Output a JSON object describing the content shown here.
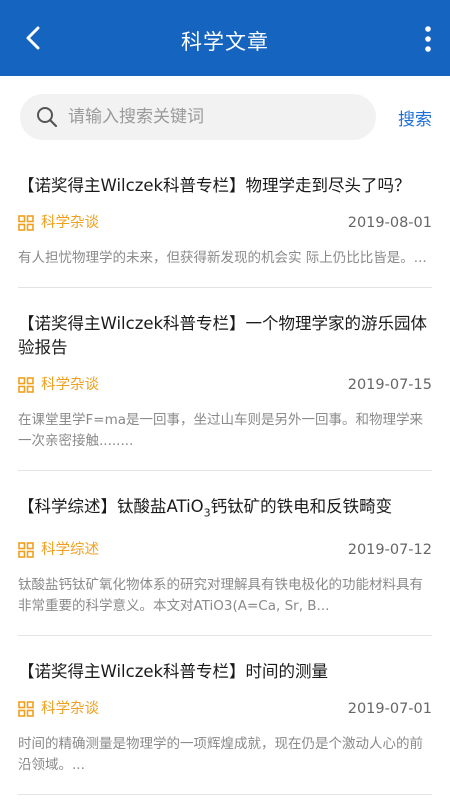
{
  "header": {
    "title": "科学文章",
    "back_icon": "chevron-left-icon",
    "more_icon": "more-vert-icon",
    "bg_color": "#1565c0"
  },
  "search": {
    "placeholder": "请输入搜索关键词",
    "value": "",
    "button_label": "搜索",
    "icon": "search-icon"
  },
  "articles": [
    {
      "title": "【诺奖得主Wilczek科普专栏】物理学走到尽头了吗？",
      "category": "科学杂谈",
      "date": "2019-08-01",
      "summary": "有人担忧物理学的未来，但获得新发现的机会实 际上仍比比皆是。..."
    },
    {
      "title": "【诺奖得主Wilczek科普专栏】一个物理学家的游乐园体验报告",
      "category": "科学杂谈",
      "date": "2019-07-15",
      "summary": "在课堂里学F=ma是一回事，坐过山车则是另外一回事。和物理学来一次亲密接触........"
    },
    {
      "title_before": "【科学综述】钛酸盐ATiO",
      "title_sub": "3",
      "title_after": "钙钛矿的铁电和反铁畸变",
      "category": "科学综述",
      "date": "2019-07-12",
      "summary": "钛酸盐钙钛矿氧化物体系的研究对理解具有铁电极化的功能材料具有非常重要的科学意义。本文对ATiO3(A=Ca, Sr, B..."
    },
    {
      "title": "【诺奖得主Wilczek科普专栏】时间的测量",
      "category": "科学杂谈",
      "date": "2019-07-01",
      "summary": "时间的精确测量是物理学的一项辉煌成就，现在仍是个激动人心的前沿领域。..."
    }
  ],
  "colors": {
    "category": "#f0a020",
    "search_button": "#1e6fd9"
  }
}
